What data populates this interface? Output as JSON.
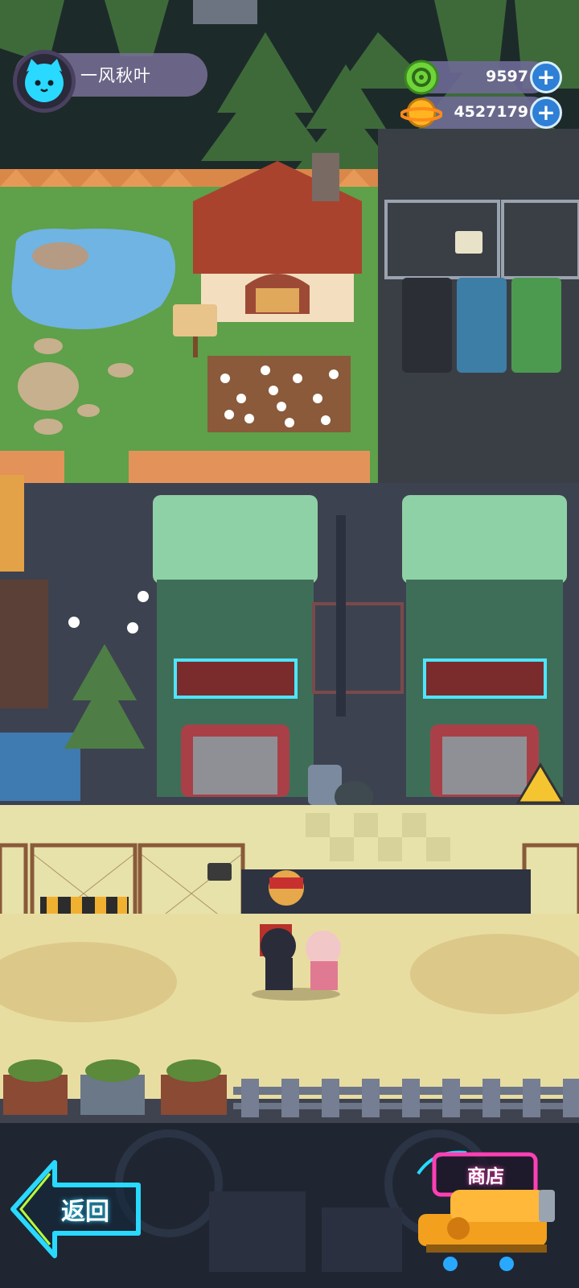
{
  "player": {
    "name": "一风秋叶",
    "avatar_icon": "cyan-cat-face-icon"
  },
  "currencies": [
    {
      "name": "green-gem",
      "icon": "green-token-icon",
      "value": "9597",
      "add_icon": "plus-icon"
    },
    {
      "name": "gold-planet",
      "icon": "gold-planet-coin-icon",
      "value": "4527179",
      "add_icon": "plus-icon"
    }
  ],
  "navigation": {
    "back_label": "返回",
    "shop_label": "商店"
  },
  "colors": {
    "accent_cyan": "#29d9ff",
    "neon_pink": "#ff3fb5",
    "hud_pill": "#6e6996",
    "plus_blue": "#2e7fd6"
  }
}
